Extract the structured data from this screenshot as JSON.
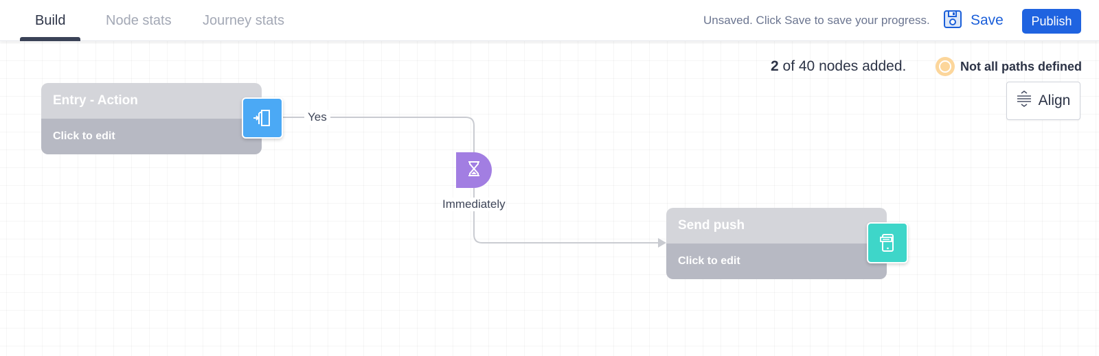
{
  "tabs": [
    {
      "label": "Build",
      "active": true
    },
    {
      "label": "Node stats",
      "active": false
    },
    {
      "label": "Journey stats",
      "active": false
    }
  ],
  "toolbar": {
    "unsaved_message": "Unsaved. Click Save to save your progress.",
    "save_label": "Save",
    "publish_label": "Publish"
  },
  "canvas": {
    "nodes_count": "2",
    "nodes_count_suffix": "of 40 nodes added.",
    "paths_status": "Not all paths defined",
    "align_label": "Align"
  },
  "nodes": {
    "entry": {
      "title": "Entry - Action",
      "subtitle": "Click to edit",
      "icon": "entry-door-icon"
    },
    "send_push": {
      "title": "Send push",
      "subtitle": "Click to edit",
      "icon": "mobile-push-icon"
    }
  },
  "edges": {
    "yes_label": "Yes",
    "delay_label": "Immediately",
    "delay_icon": "hourglass-icon"
  },
  "colors": {
    "primary": "#1f63e0",
    "entry_icon_bg": "#4ba9f5",
    "push_icon_bg": "#3ed6c9",
    "delay_bg": "#a27ee2",
    "warning": "#fcd69b"
  }
}
